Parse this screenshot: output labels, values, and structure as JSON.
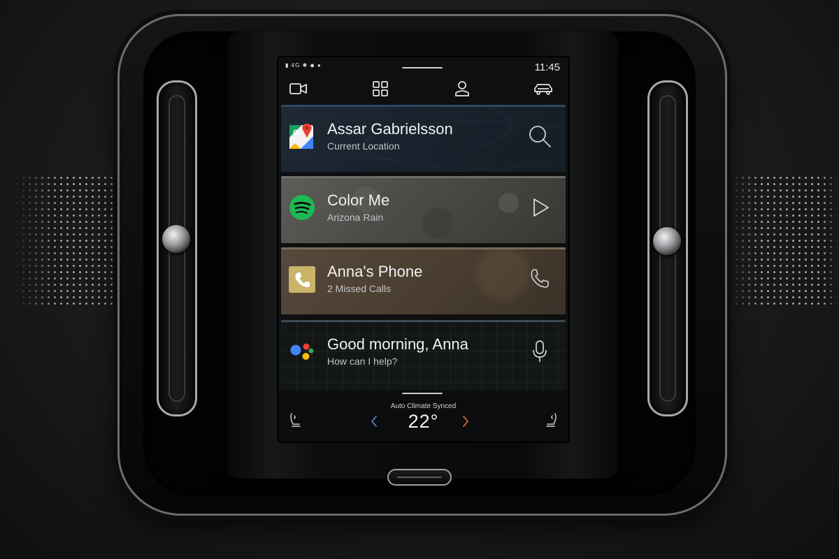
{
  "status_bar": {
    "signal_text": "4G",
    "clock": "11:45"
  },
  "top_bar": {
    "icons": [
      "video-camera-icon",
      "apps-grid-icon",
      "profile-icon",
      "car-icon"
    ]
  },
  "cards": {
    "navigation": {
      "app_icon": "google-maps-icon",
      "title": "Assar Gabrielsson",
      "subtitle": "Current Location",
      "action_icon": "search-icon"
    },
    "music": {
      "app_icon": "spotify-icon",
      "title": "Color Me",
      "subtitle": "Arizona Rain",
      "action_icon": "play-icon"
    },
    "phone": {
      "app_icon": "phone-app-icon",
      "title": "Anna's Phone",
      "subtitle": "2 Missed Calls",
      "action_icon": "phone-icon"
    },
    "assistant": {
      "app_icon": "google-assistant-icon",
      "title": "Good morning, Anna",
      "subtitle": "How can I help?",
      "action_icon": "microphone-icon"
    }
  },
  "climate": {
    "label": "Auto Climate Synced",
    "temperature": "22°"
  },
  "colors": {
    "spotify_green": "#1DB954",
    "phone_gold": "#C9B46A",
    "assistant_blue": "#4285F4",
    "assistant_red": "#EA4335",
    "assistant_yellow": "#FBBC05",
    "assistant_green": "#34A853",
    "temp_down_arrow": "#4f7fb8",
    "temp_up_arrow": "#c36a3a"
  }
}
